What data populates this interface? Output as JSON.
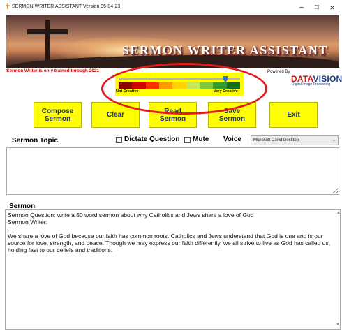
{
  "window": {
    "title": "SERMON WRITER ASSISTANT",
    "version": "Version 05-04-23",
    "minimize_glyph": "–",
    "maximize_glyph": "☐",
    "close_glyph": "×",
    "icon": "cross-icon"
  },
  "banner": {
    "title": "SERMON WRITER ASSISTANT"
  },
  "notice": "Sermon Writer is only trained through 2021",
  "creativity_meter": {
    "low_label": "Not Creative",
    "high_label": "Very Creative",
    "level": 0.88,
    "segment_colors": [
      "#8b0000",
      "#d00000",
      "#ff3300",
      "#ff9900",
      "#ffd200",
      "#c4e85a",
      "#7dcb3a",
      "#2f9e2f",
      "#156b1e"
    ],
    "thumb_color": "#2476d2",
    "highlight_color": "#e01c1c"
  },
  "powered_by": {
    "label": "Powered By",
    "logo_data": "DATA",
    "logo_vision": "VISION",
    "logo_sub": "Digital Image Processing"
  },
  "buttons": {
    "compose": "Compose\nSermon",
    "clear": "Clear",
    "read": "Read\nSermon",
    "save": "Save\nSermon",
    "exit": "Exit"
  },
  "topic": {
    "label": "Sermon Topic",
    "value": ""
  },
  "options": {
    "dictate_label": "Dictate Question",
    "dictate_checked": false,
    "mute_label": "Mute",
    "mute_checked": false,
    "voice_label": "Voice",
    "voice_value": "Microsoft David Desktop"
  },
  "sermon": {
    "label": "Sermon",
    "question_line": "Sermon Question: write a 50 word sermon about why Catholics and Jews share a love of God",
    "writer_line": "Sermon Writer:",
    "body": "We share a love of God because our faith has common roots. Catholics and Jews understand that God is one and is our source for love, strength, and peace. Though we may express our faith differently, we all strive to live as God has called us, holding fast to our beliefs and traditions."
  },
  "colors": {
    "button_bg": "#fffd01",
    "button_text": "#1f3763",
    "notice_text": "#c40000"
  }
}
